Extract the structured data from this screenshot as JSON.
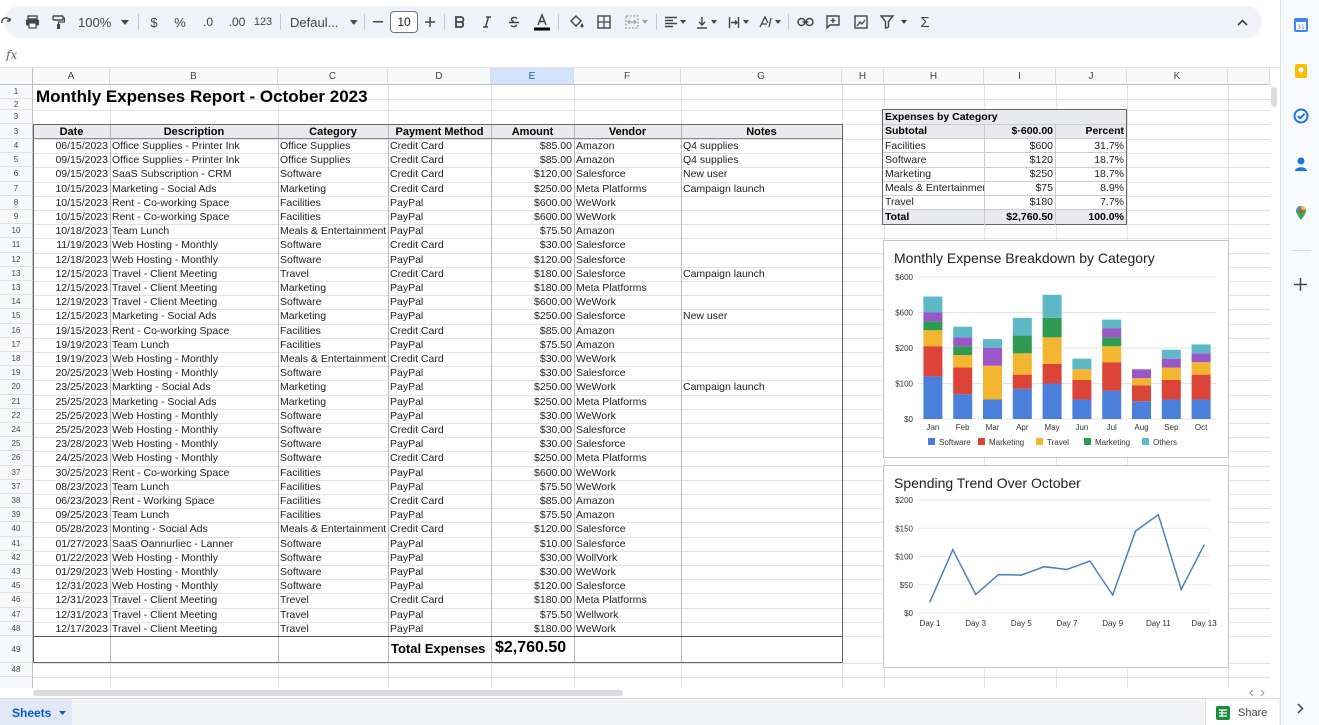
{
  "toolbar": {
    "zoom": "100%",
    "currency": "$",
    "percent": "%",
    "dec_decrease": ".0",
    "dec_increase": ".00",
    "number_format": "123",
    "font": "Defaul...",
    "font_size": "10"
  },
  "formula_bar": {
    "fx": "fx",
    "value": ""
  },
  "columns": [
    "A",
    "B",
    "C",
    "D",
    "E",
    "F",
    "G",
    "H",
    "H",
    "I",
    "J",
    "K"
  ],
  "title": "Monthly Expenses Report - October 2023",
  "headers": [
    "Date",
    "Description",
    "Category",
    "Payment Method",
    "Amount",
    "Vendor",
    "Notes"
  ],
  "rows": [
    {
      "n": "4",
      "date": "06/15/2023",
      "desc": "Office Supplies - Printer Ink",
      "cat": "Office Supplies",
      "pay": "Credit Card",
      "amt": "$85.00",
      "vendor": "Amazon",
      "notes": "Q4 supplies"
    },
    {
      "n": "5",
      "date": "09/15/2023",
      "desc": "Office Supplies - Printer Ink",
      "cat": "Office Supplies",
      "pay": "Credit Card",
      "amt": "$85.00",
      "vendor": "Amazon",
      "notes": "Q4 supplies"
    },
    {
      "n": "6",
      "date": "09/15/2023",
      "desc": "SaaS Subscription - CRM",
      "cat": "Software",
      "pay": "Credit Card",
      "amt": "$120.00",
      "vendor": "Salesforce",
      "notes": "New user"
    },
    {
      "n": "7",
      "date": "10/15/2023",
      "desc": "Marketing - Social Ads",
      "cat": "Marketing",
      "pay": "Credit Card",
      "amt": "$250.00",
      "vendor": "Meta Platforms",
      "notes": "Campaign launch"
    },
    {
      "n": "8",
      "date": "10/15/2023",
      "desc": "Rent - Co-working Space",
      "cat": "Facilities",
      "pay": "PayPal",
      "amt": "$600.00",
      "vendor": "WeWork",
      "notes": ""
    },
    {
      "n": "9",
      "date": "10/15/2023",
      "desc": "Rent - Co-working Space",
      "cat": "Facilities",
      "pay": "PayPal",
      "amt": "$600.00",
      "vendor": "WeWork",
      "notes": ""
    },
    {
      "n": "10",
      "date": "10/18/2023",
      "desc": "Team Lunch",
      "cat": "Meals & Entertainment",
      "pay": "PayPal",
      "amt": "$75.50",
      "vendor": "Amazon",
      "notes": ""
    },
    {
      "n": "11",
      "date": "11/19/2023",
      "desc": "Web Hosting - Monthly",
      "cat": "Software",
      "pay": "Credit Card",
      "amt": "$30.00",
      "vendor": "Salesforce",
      "notes": ""
    },
    {
      "n": "12",
      "date": "12/18/2023",
      "desc": "Web Hosting - Monthly",
      "cat": "Software",
      "pay": "PayPal",
      "amt": "$120.00",
      "vendor": "Salesforce",
      "notes": ""
    },
    {
      "n": "13",
      "date": "12/15/2023",
      "desc": "Travel - Client Meeting",
      "cat": "Travel",
      "pay": "Credit Card",
      "amt": "$180.00",
      "vendor": "Salesforce",
      "notes": "Campaign launch"
    },
    {
      "n": "13",
      "date": "12/15/2023",
      "desc": "Travel - Client Meeting",
      "cat": "Marketing",
      "pay": "PayPal",
      "amt": "$180.00",
      "vendor": "Meta Platforms",
      "notes": ""
    },
    {
      "n": "14",
      "date": "12/19/2023",
      "desc": "Travel - Client Meeting",
      "cat": "Software",
      "pay": "PayPal",
      "amt": "$600.00",
      "vendor": "WeWork",
      "notes": ""
    },
    {
      "n": "15",
      "date": "12/15/2023",
      "desc": "Marketing - Social Ads",
      "cat": "Marketing",
      "pay": "PayPal",
      "amt": "$250.00",
      "vendor": "Salesforce",
      "notes": "New user"
    },
    {
      "n": "16",
      "date": "19/15/2023",
      "desc": "Rent - Co-working Space",
      "cat": "Facilities",
      "pay": "Credit Card",
      "amt": "$85.00",
      "vendor": "Amazon",
      "notes": ""
    },
    {
      "n": "17",
      "date": "19/19/2023",
      "desc": "Team Lunch",
      "cat": "Facilities",
      "pay": "PayPal",
      "amt": "$75.50",
      "vendor": "Amazon",
      "notes": ""
    },
    {
      "n": "18",
      "date": "19/19/2023",
      "desc": "Web Hosting - Monthly",
      "cat": "Meals & Entertainment",
      "pay": "Credit Card",
      "amt": "$30.00",
      "vendor": "WeWork",
      "notes": ""
    },
    {
      "n": "19",
      "date": "20/25/2023",
      "desc": "Web Hosting - Monthly",
      "cat": "Software",
      "pay": "PayPal",
      "amt": "$30.00",
      "vendor": "Salesforce",
      "notes": ""
    },
    {
      "n": "20",
      "date": "23/25/2023",
      "desc": "Markting - Social Ads",
      "cat": "Marketing",
      "pay": "PayPal",
      "amt": "$250.00",
      "vendor": "WeWork",
      "notes": "Campaign launch"
    },
    {
      "n": "21",
      "date": "25/25/2023",
      "desc": "Marketing - Social Ads",
      "cat": "Marketing",
      "pay": "PayPal",
      "amt": "$250.00",
      "vendor": "Meta Platforms",
      "notes": ""
    },
    {
      "n": "22",
      "date": "25/25/2023",
      "desc": "Web Hosting - Monthly",
      "cat": "Software",
      "pay": "PayPal",
      "amt": "$30.00",
      "vendor": "WeWork",
      "notes": ""
    },
    {
      "n": "24",
      "date": "25/25/2023",
      "desc": "Web Hosting - Monthly",
      "cat": "Software",
      "pay": "Credit Card",
      "amt": "$30.00",
      "vendor": "Salesforce",
      "notes": ""
    },
    {
      "n": "25",
      "date": "23/28/2023",
      "desc": "Web Hosting - Monthly",
      "cat": "Software",
      "pay": "PayPal",
      "amt": "$30.00",
      "vendor": "Salesforce",
      "notes": ""
    },
    {
      "n": "26",
      "date": "24/25/2023",
      "desc": "Web Hosting - Monthly",
      "cat": "Software",
      "pay": "Credit Card",
      "amt": "$250.00",
      "vendor": "Meta Platforms",
      "notes": ""
    },
    {
      "n": "37",
      "date": "30/25/2023",
      "desc": "Rent - Co-working Space",
      "cat": "Facilities",
      "pay": "PayPal",
      "amt": "$600.00",
      "vendor": "WeWork",
      "notes": ""
    },
    {
      "n": "37",
      "date": "08/23/2023",
      "desc": "Team Lunch",
      "cat": "Facilities",
      "pay": "PayPal",
      "amt": "$75.50",
      "vendor": "WeWork",
      "notes": ""
    },
    {
      "n": "38",
      "date": "06/23/2023",
      "desc": "Rent - Working Space",
      "cat": "Facilities",
      "pay": "Credit Card",
      "amt": "$85.00",
      "vendor": "Amazon",
      "notes": ""
    },
    {
      "n": "39",
      "date": "09/25/2023",
      "desc": "Team Lunch",
      "cat": "Facilities",
      "pay": "PayPal",
      "amt": "$75.50",
      "vendor": "Amazon",
      "notes": ""
    },
    {
      "n": "40",
      "date": "05/28/2023",
      "desc": "Monting - Social Ads",
      "cat": "Meals & Entertainment",
      "pay": "Credit Card",
      "amt": "$120.00",
      "vendor": "Salesforce",
      "notes": ""
    },
    {
      "n": "41",
      "date": "01/27/2023",
      "desc": "SaaS Oannurliec - Lanner",
      "cat": "Software",
      "pay": "PayPal",
      "amt": "$10.00",
      "vendor": "Salesforce",
      "notes": ""
    },
    {
      "n": "42",
      "date": "01/22/2023",
      "desc": "Web Hosting - Monthly",
      "cat": "Software",
      "pay": "PayPal",
      "amt": "$30.00",
      "vendor": "WollVork",
      "notes": ""
    },
    {
      "n": "43",
      "date": "01/29/2023",
      "desc": "Web Hosting - Monthly",
      "cat": "Software",
      "pay": "PayPal",
      "amt": "$30.00",
      "vendor": "WeWork",
      "notes": ""
    },
    {
      "n": "45",
      "date": "12/31/2023",
      "desc": "Web Hosting - Monthly",
      "cat": "Software",
      "pay": "PayPal",
      "amt": "$120.00",
      "vendor": "Salesforce",
      "notes": ""
    },
    {
      "n": "46",
      "date": "12/31/2023",
      "desc": "Travel - Client Meeting",
      "cat": "Trevel",
      "pay": "Credit Card",
      "amt": "$180.00",
      "vendor": "Meta Platforms",
      "notes": ""
    },
    {
      "n": "47",
      "date": "12/31/2023",
      "desc": "Travel - Client Meeting",
      "cat": "Travel",
      "pay": "PayPal",
      "amt": "$75.50",
      "vendor": "Wellwork",
      "notes": ""
    },
    {
      "n": "48",
      "date": "12/17/2023",
      "desc": "Travel - Client Meeting",
      "cat": "Travel",
      "pay": "PayPal",
      "amt": "$180.00",
      "vendor": "WeWork",
      "notes": ""
    }
  ],
  "total": {
    "label": "Total Expenses",
    "value": "$2,760.50",
    "row_num": "49"
  },
  "extra_row": "48",
  "summary": {
    "title": "Expenses by Category",
    "head": [
      "Subtotal",
      "$·600.00",
      "Percent"
    ],
    "rows": [
      {
        "cat": "Facilities",
        "amt": "$600",
        "pct": "31.7%"
      },
      {
        "cat": "Software",
        "amt": "$120",
        "pct": "18.7%"
      },
      {
        "cat": "Marketing",
        "amt": "$250",
        "pct": "18.7%"
      },
      {
        "cat": "Meals & Entertainment",
        "amt": "$75",
        "pct": "8.9%"
      },
      {
        "cat": "Travel",
        "amt": "$180",
        "pct": "7.7%"
      }
    ],
    "total": {
      "cat": "Total",
      "amt": "$2,760.50",
      "pct": "100.0%"
    }
  },
  "chart_data": [
    {
      "type": "bar",
      "stacked": true,
      "title": "Monthly Expense Breakdown by Category",
      "categories": [
        "Jan",
        "Feb",
        "Mar",
        "Apr",
        "May",
        "Jun",
        "Jul",
        "Aug",
        "Sep",
        "Oct"
      ],
      "yticks": [
        "$0",
        "$100",
        "$200",
        "$600",
        "$600"
      ],
      "ylim": [
        0,
        400
      ],
      "series": [
        {
          "name": "Software",
          "color": "#4a7fdb",
          "values": [
            120,
            70,
            55,
            85,
            100,
            55,
            80,
            50,
            55,
            55
          ]
        },
        {
          "name": "Marketing",
          "color": "#dc4437",
          "values": [
            85,
            75,
            0,
            40,
            55,
            55,
            80,
            45,
            55,
            70
          ]
        },
        {
          "name": "Travel",
          "color": "#f3b631",
          "values": [
            45,
            35,
            95,
            60,
            75,
            30,
            45,
            20,
            35,
            35
          ]
        },
        {
          "name": "Marketing",
          "color": "#2f9a52",
          "values": [
            25,
            25,
            0,
            50,
            55,
            0,
            25,
            0,
            0,
            0
          ]
        },
        {
          "name": "",
          "color": "#9b56c9",
          "values": [
            25,
            25,
            50,
            0,
            0,
            0,
            25,
            25,
            25,
            25
          ]
        },
        {
          "name": "Others",
          "color": "#5fb8c7",
          "values": [
            45,
            30,
            25,
            50,
            65,
            30,
            25,
            0,
            25,
            25
          ]
        }
      ],
      "legend": "bottom"
    },
    {
      "type": "line",
      "title": "Spending Trend Over October",
      "x_labels": [
        "Day 1",
        "Day 3",
        "Day 5",
        "Day 7",
        "Day 9",
        "Day 11",
        "Day 13"
      ],
      "yticks": [
        "$0",
        "$50",
        "$100",
        "$150",
        "$200"
      ],
      "ylim": [
        0,
        200
      ],
      "color": "#4a7fbf",
      "x": [
        1,
        2,
        3,
        4,
        5,
        6,
        7,
        8,
        9,
        10,
        11,
        12,
        13
      ],
      "values": [
        20,
        112,
        33,
        68,
        67,
        82,
        77,
        92,
        32,
        145,
        174,
        42,
        120
      ]
    }
  ],
  "bottom": {
    "sheets_label": "Sheets",
    "share_label": "Share"
  }
}
